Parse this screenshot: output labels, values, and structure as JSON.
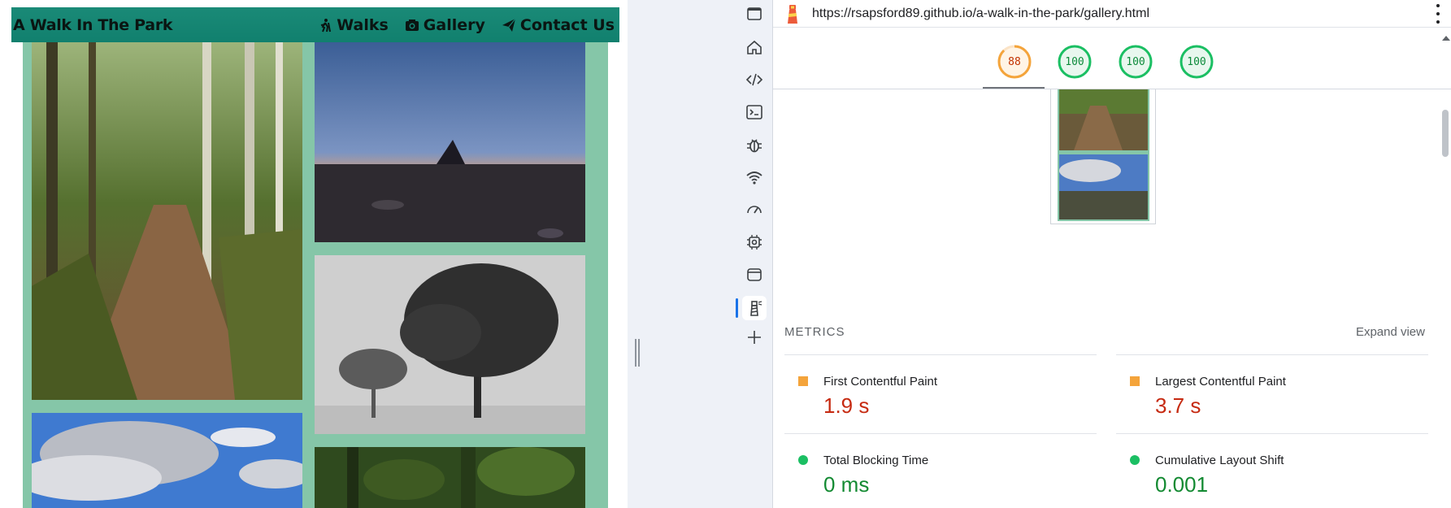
{
  "site": {
    "brand": "A Walk In The Park",
    "nav": [
      {
        "label": "Walks",
        "icon": "hiking-icon"
      },
      {
        "label": "Gallery",
        "icon": "camera-icon"
      },
      {
        "label": "Contact Us",
        "icon": "paper-plane-icon"
      }
    ]
  },
  "gallery": {
    "photos": [
      {
        "name": "woodland-path-photo",
        "alt": "woodland path"
      },
      {
        "name": "sunset-cairn-photo",
        "alt": "sunset over moorland cairn"
      },
      {
        "name": "misty-trees-photo",
        "alt": "trees in mist"
      },
      {
        "name": "cloudy-sky-photo",
        "alt": "cloudy sky"
      },
      {
        "name": "green-forest-photo",
        "alt": "forest"
      }
    ]
  },
  "devtools": {
    "rail_icons": [
      "window-icon",
      "home-icon",
      "code-icon",
      "console-icon",
      "bug-icon",
      "wifi-icon",
      "gauge-icon",
      "chip-icon",
      "application-icon",
      "lighthouse-icon",
      "plus-icon"
    ],
    "active_tool": "lighthouse-icon"
  },
  "lighthouse": {
    "url": "https://rsapsford89.github.io/a-walk-in-the-park/gallery.html",
    "scores": [
      {
        "value": "88",
        "status": "average",
        "color": "#e67700"
      },
      {
        "value": "100",
        "status": "pass",
        "color": "#0c8a3a"
      },
      {
        "value": "100",
        "status": "pass",
        "color": "#0c8a3a"
      },
      {
        "value": "100",
        "status": "pass",
        "color": "#0c8a3a"
      }
    ],
    "metrics_title": "METRICS",
    "expand_label": "Expand view",
    "metrics": [
      {
        "label": "First Contentful Paint",
        "value": "1.9 s",
        "status": "average"
      },
      {
        "label": "Largest Contentful Paint",
        "value": "3.7 s",
        "status": "average"
      },
      {
        "label": "Total Blocking Time",
        "value": "0 ms",
        "status": "pass"
      },
      {
        "label": "Cumulative Layout Shift",
        "value": "0.001",
        "status": "pass"
      }
    ]
  },
  "colors": {
    "nav_bg": "#148574",
    "gallery_bg": "#85c6a8",
    "average": "#f4a43b",
    "pass": "#1bbf63",
    "bad_text": "#c62a11",
    "good_text": "#138a32"
  }
}
